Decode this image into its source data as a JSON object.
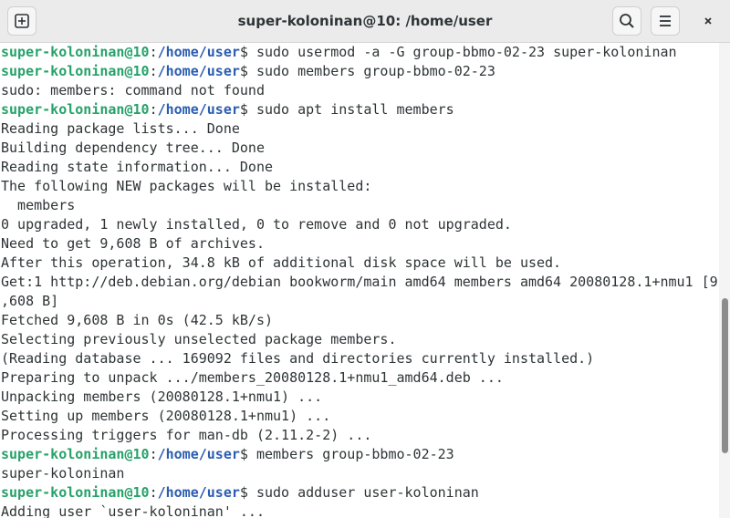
{
  "window": {
    "title": "super-koloninan@10: /home/user",
    "buttons": {
      "new_tab_icon": "new-tab-icon",
      "search_icon": "search-icon",
      "menu_icon": "hamburger-menu-icon",
      "close_icon": "close-icon"
    }
  },
  "terminal": {
    "lines": [
      {
        "user": "super-koloninan@10",
        "sep": ":",
        "path": "/home/user",
        "prompt": "$ ",
        "text": "sudo usermod -a -G group-bbmo-02-23 super-koloninan"
      },
      {
        "user": "super-koloninan@10",
        "sep": ":",
        "path": "/home/user",
        "prompt": "$ ",
        "text": "sudo members group-bbmo-02-23"
      },
      {
        "text": "sudo: members: command not found"
      },
      {
        "user": "super-koloninan@10",
        "sep": ":",
        "path": "/home/user",
        "prompt": "$ ",
        "text": "sudo apt install members"
      },
      {
        "text": "Reading package lists... Done"
      },
      {
        "text": "Building dependency tree... Done"
      },
      {
        "text": "Reading state information... Done"
      },
      {
        "text": "The following NEW packages will be installed:"
      },
      {
        "text": "  members"
      },
      {
        "text": "0 upgraded, 1 newly installed, 0 to remove and 0 not upgraded."
      },
      {
        "text": "Need to get 9,608 B of archives."
      },
      {
        "text": "After this operation, 34.8 kB of additional disk space will be used."
      },
      {
        "text": "Get:1 http://deb.debian.org/debian bookworm/main amd64 members amd64 20080128.1+nmu1 [9"
      },
      {
        "text": ",608 B]"
      },
      {
        "text": "Fetched 9,608 B in 0s (42.5 kB/s)"
      },
      {
        "text": "Selecting previously unselected package members."
      },
      {
        "text": "(Reading database ... 169092 files and directories currently installed.)"
      },
      {
        "text": "Preparing to unpack .../members_20080128.1+nmu1_amd64.deb ..."
      },
      {
        "text": "Unpacking members (20080128.1+nmu1) ..."
      },
      {
        "text": "Setting up members (20080128.1+nmu1) ..."
      },
      {
        "text": "Processing triggers for man-db (2.11.2-2) ..."
      },
      {
        "user": "super-koloninan@10",
        "sep": ":",
        "path": "/home/user",
        "prompt": "$ ",
        "text": "members group-bbmo-02-23"
      },
      {
        "text": "super-koloninan"
      },
      {
        "user": "super-koloninan@10",
        "sep": ":",
        "path": "/home/user",
        "prompt": "$ ",
        "text": "sudo adduser user-koloninan"
      },
      {
        "text": "Adding user `user-koloninan' ..."
      }
    ]
  },
  "colors": {
    "prompt_user": "#26a269",
    "prompt_path": "#2a5db0",
    "text": "#2e3436",
    "background": "#ffffff"
  }
}
